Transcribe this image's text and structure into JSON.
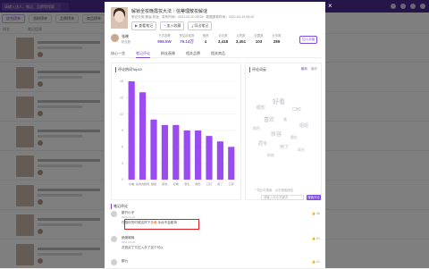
{
  "topbar": {
    "search_placeholder": "请输入达人、笔记、品牌等搜索"
  },
  "background_page": {
    "tabs": [
      "综合榜单",
      "涨粉榜单",
      "品牌榜单",
      "商品榜单"
    ],
    "columns": [
      "排名",
      "笔记信息"
    ],
    "rank_prefix": "NO.",
    "rows": [
      {
        "rank": "",
        "num1": "",
        "num2": "",
        "num3": ""
      },
      {
        "rank": "",
        "num1": "",
        "num2": "",
        "num3": ""
      },
      {
        "rank": "",
        "num1": "",
        "num2": "",
        "num3": ""
      },
      {
        "rank": "",
        "num1": "",
        "num2": "",
        "num3": ""
      },
      {
        "rank": "",
        "num1": "",
        "num2": "",
        "num3": ""
      },
      {
        "rank": "",
        "num1": "",
        "num2": "",
        "num3": ""
      },
      {
        "rank": "",
        "num1": "",
        "num2": "",
        "num3": ""
      },
      {
        "rank": "",
        "num1": "",
        "num2": "",
        "num3": ""
      }
    ]
  },
  "modal": {
    "close_label": "×",
    "title": "解锁全妆晚霞妆大法｜信蒂理散妆解谜",
    "meta": "笔记分类:美妆-彩妆 · 发布时间：2021-03-20 20:28 · 数据更新时间：2021-04-13 09:20",
    "buttons": [
      {
        "icon": "▶",
        "label": "查看笔记"
      },
      {
        "icon": "+",
        "label": "加入收藏"
      },
      {
        "icon": "⤓",
        "label": "导出笔记"
      }
    ],
    "author": {
      "name": "张晓",
      "fans_label": "粉丝数"
    },
    "stats": [
      {
        "label": "千次观看",
        "value": "958.5W",
        "highlight": true
      },
      {
        "label": "预估阅读数",
        "value": "79.14万",
        "highlight": true
      },
      {
        "label": "推荐",
        "value": "4",
        "highlight": false
      }
    ],
    "stats_right": [
      {
        "label": "评论数",
        "value": "3,418"
      },
      {
        "label": "点赞数",
        "value": "3,451"
      },
      {
        "label": "收藏数",
        "value": "103"
      },
      {
        "label": "分享数",
        "value": "289"
      }
    ],
    "join_label": "加入对接",
    "tabs": [
      {
        "label": "核心一览",
        "active": false
      },
      {
        "label": "笔记评论",
        "active": true
      },
      {
        "label": "粉丝画像",
        "active": false
      },
      {
        "label": "相关品牌",
        "active": false
      },
      {
        "label": "相关商品",
        "active": false
      }
    ],
    "chart_panel": {
      "title": "评论热词Top10"
    },
    "cloud_panel": {
      "title": "评论词云",
      "links": [
        {
          "label": "最新",
          "active": true
        },
        {
          "label": "最热",
          "active": false
        }
      ],
      "words": [
        "好看",
        "眼影",
        "口红",
        "喜欢",
        "美",
        "姐姐",
        "颜色",
        "妆容",
        "腮红",
        "眉毛",
        "用了",
        "高光",
        "粉底"
      ],
      "note": "* 词云可搜索，点击搜索按钮",
      "input_placeholder": "请输入评论关键词",
      "search_label": "搜索评论"
    },
    "comments_section": {
      "title": "笔记评论",
      "items": [
        {
          "name": "那只小子",
          "time": "2021-03-21",
          "text": "在陪伴的时候这样下去🔥永远不会散场",
          "likes": "48"
        },
        {
          "name": "绝绝味味",
          "time": "2021-03-22",
          "text": "花钱买了又拉入灰了这个可以",
          "likes": "51"
        },
        {
          "name": "那九",
          "time": "2021-03-23",
          "text": "",
          "likes": "41"
        }
      ]
    }
  },
  "chart_data": {
    "type": "bar",
    "title": "评论热词Top10",
    "categories": [
      "好看",
      "喜欢的颜色",
      "姐姐",
      "颜色",
      "好看",
      "眉毛",
      "眼影",
      "口红",
      "用了",
      "口罩"
    ],
    "values": [
      18,
      16,
      11,
      10,
      10,
      9,
      9,
      8,
      7,
      6
    ],
    "ylim": [
      0,
      18
    ],
    "yticks": [
      0,
      3,
      6,
      9,
      12,
      15,
      18
    ],
    "bar_color": "#9b4cf0",
    "grid": true
  }
}
